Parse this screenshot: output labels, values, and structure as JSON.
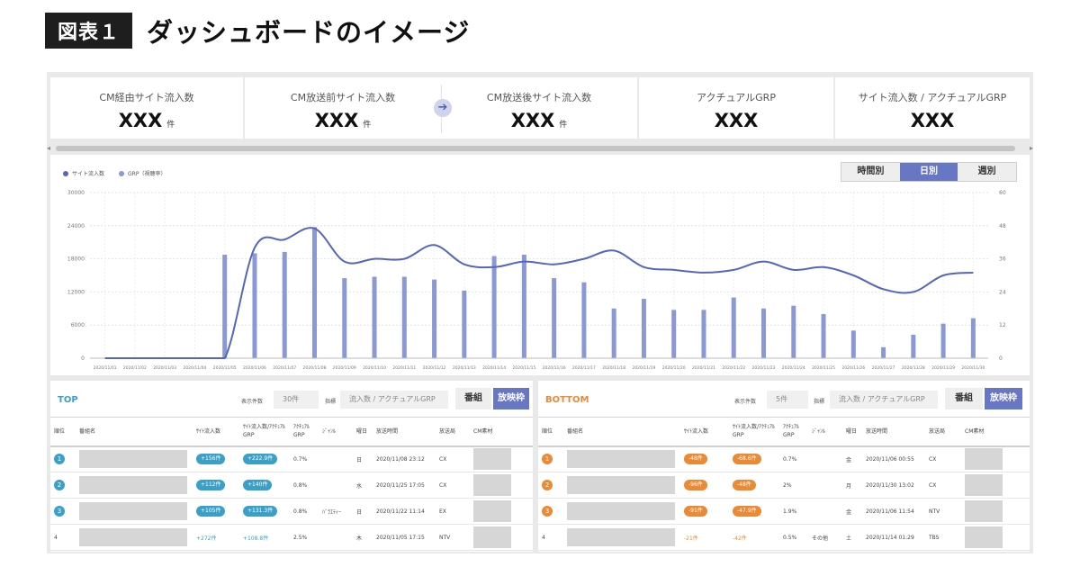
{
  "figure": {
    "label": "図表１",
    "title": "ダッシュボードのイメージ"
  },
  "kpis": [
    {
      "label": "CM経由サイト流入数",
      "value": "XXX",
      "unit": "件"
    },
    {
      "label": "CM放送前サイト流入数",
      "value": "XXX",
      "unit": "件"
    },
    {
      "label": "CM放送後サイト流入数",
      "value": "XXX",
      "unit": "件"
    },
    {
      "label": "アクチュアルGRP",
      "value": "XXX",
      "unit": ""
    },
    {
      "label": "サイト流入数 / アクチュアルGRP",
      "value": "XXX",
      "unit": ""
    }
  ],
  "arrow_icon": "arrow-right-icon",
  "view_toggle": {
    "options": [
      "時間別",
      "日別",
      "週別"
    ],
    "selected": "日別"
  },
  "colors": {
    "accent": "#6877c4",
    "line": "#5566bb",
    "bar": "#8b98d6",
    "top": "#3ba0c8",
    "bottom": "#ea8a34"
  },
  "chart_data": {
    "type": "bar",
    "legend": [
      "サイト流入数",
      "GRP（視聴率）"
    ],
    "legend_position": "top-left",
    "categories": [
      "2020/11/01",
      "2020/11/02",
      "2020/11/03",
      "2020/11/04",
      "2020/11/05",
      "2020/11/06",
      "2020/11/07",
      "2020/11/08",
      "2020/11/09",
      "2020/11/10",
      "2020/11/11",
      "2020/11/12",
      "2020/11/13",
      "2020/11/14",
      "2020/11/15",
      "2020/11/16",
      "2020/11/17",
      "2020/11/18",
      "2020/11/19",
      "2020/11/20",
      "2020/11/21",
      "2020/11/22",
      "2020/11/23",
      "2020/11/24",
      "2020/11/25",
      "2020/11/26",
      "2020/11/27",
      "2020/11/28",
      "2020/11/29",
      "2020/11/30"
    ],
    "bars": {
      "name": "GRP（視聴率）",
      "axis": "right",
      "values": [
        0,
        0,
        0,
        0,
        37.5,
        38,
        38.5,
        47.5,
        29,
        29.5,
        29.5,
        28.5,
        24.5,
        37,
        37.5,
        29,
        27.5,
        18,
        21.5,
        17.5,
        17.5,
        22,
        18,
        19,
        16,
        10,
        4,
        8.5,
        12.5,
        14.5
      ]
    },
    "line": {
      "name": "サイト流入数",
      "axis": "left",
      "values": [
        0,
        0,
        0,
        0,
        0,
        20000,
        21500,
        23500,
        17500,
        18000,
        18000,
        20500,
        17000,
        16500,
        17500,
        17000,
        18000,
        19500,
        16500,
        16000,
        15500,
        16000,
        17500,
        16000,
        16500,
        15000,
        12500,
        12000,
        15000,
        15500
      ]
    },
    "y_left": {
      "ticks": [
        0,
        6000,
        12000,
        18000,
        24000,
        30000
      ],
      "ylim": [
        0,
        30000
      ]
    },
    "y_right": {
      "ticks": [
        0,
        12,
        24,
        36,
        48,
        60
      ],
      "ylim": [
        0,
        60
      ]
    },
    "grid": true
  },
  "top_panel": {
    "title": "TOP",
    "count_label": "表示件数",
    "count_value": "30件",
    "metric_label": "指標",
    "metric_value": "流入数 / アクチュアルGRP",
    "segment": [
      "番組",
      "放映枠"
    ],
    "headers": [
      "順位",
      "番組名",
      "ｻｲﾄ流入数",
      "ｻｲﾄ流入数/ｱｸﾁｭｱﾙGRP",
      "ｱｸﾁｭｱﾙGRP",
      "ｼﾞｬﾝﾙ",
      "曜日",
      "放送時間",
      "放送局",
      "CM素材"
    ],
    "rows": [
      {
        "rank": "1",
        "inflow": "+156件",
        "ratio": "+222.9件",
        "grp": "0.7%",
        "genre": "",
        "day": "日",
        "time": "2020/11/08 23:12",
        "station": "CX"
      },
      {
        "rank": "2",
        "inflow": "+112件",
        "ratio": "+140件",
        "grp": "0.8%",
        "genre": "",
        "day": "水",
        "time": "2020/11/25 17:05",
        "station": "CX"
      },
      {
        "rank": "3",
        "inflow": "+105件",
        "ratio": "+131.3件",
        "grp": "0.8%",
        "genre": "ﾊﾞﾗｴﾃｨｰ",
        "day": "日",
        "time": "2020/11/22 11:14",
        "station": "EX"
      },
      {
        "rank": "4",
        "inflow": "+272件",
        "ratio": "+108.8件",
        "grp": "2.5%",
        "genre": "",
        "day": "木",
        "time": "2020/11/05 17:15",
        "station": "NTV"
      }
    ]
  },
  "bottom_panel": {
    "title": "BOTTOM",
    "count_label": "表示件数",
    "count_value": "5件",
    "metric_label": "指標",
    "metric_value": "流入数 / アクチュアルGRP",
    "segment": [
      "番組",
      "放映枠"
    ],
    "headers": [
      "順位",
      "番組名",
      "ｻｲﾄ流入数",
      "ｻｲﾄ流入数/ｱｸﾁｭｱﾙGRP",
      "ｱｸﾁｭｱﾙGRP",
      "ｼﾞｬﾝﾙ",
      "曜日",
      "放送時間",
      "放送局",
      "CM素材"
    ],
    "rows": [
      {
        "rank": "1",
        "inflow": "-48件",
        "ratio": "-68.6件",
        "grp": "0.7%",
        "genre": "",
        "day": "金",
        "time": "2020/11/06 00:55",
        "station": "CX"
      },
      {
        "rank": "2",
        "inflow": "-96件",
        "ratio": "-48件",
        "grp": "2%",
        "genre": "",
        "day": "月",
        "time": "2020/11/30 13:02",
        "station": "CX"
      },
      {
        "rank": "3",
        "inflow": "-91件",
        "ratio": "-47.9件",
        "grp": "1.9%",
        "genre": "",
        "day": "金",
        "time": "2020/11/06 11:54",
        "station": "NTV"
      },
      {
        "rank": "4",
        "inflow": "-21件",
        "ratio": "-42件",
        "grp": "0.5%",
        "genre": "その他",
        "day": "土",
        "time": "2020/11/14 01:29",
        "station": "TBS"
      }
    ]
  }
}
